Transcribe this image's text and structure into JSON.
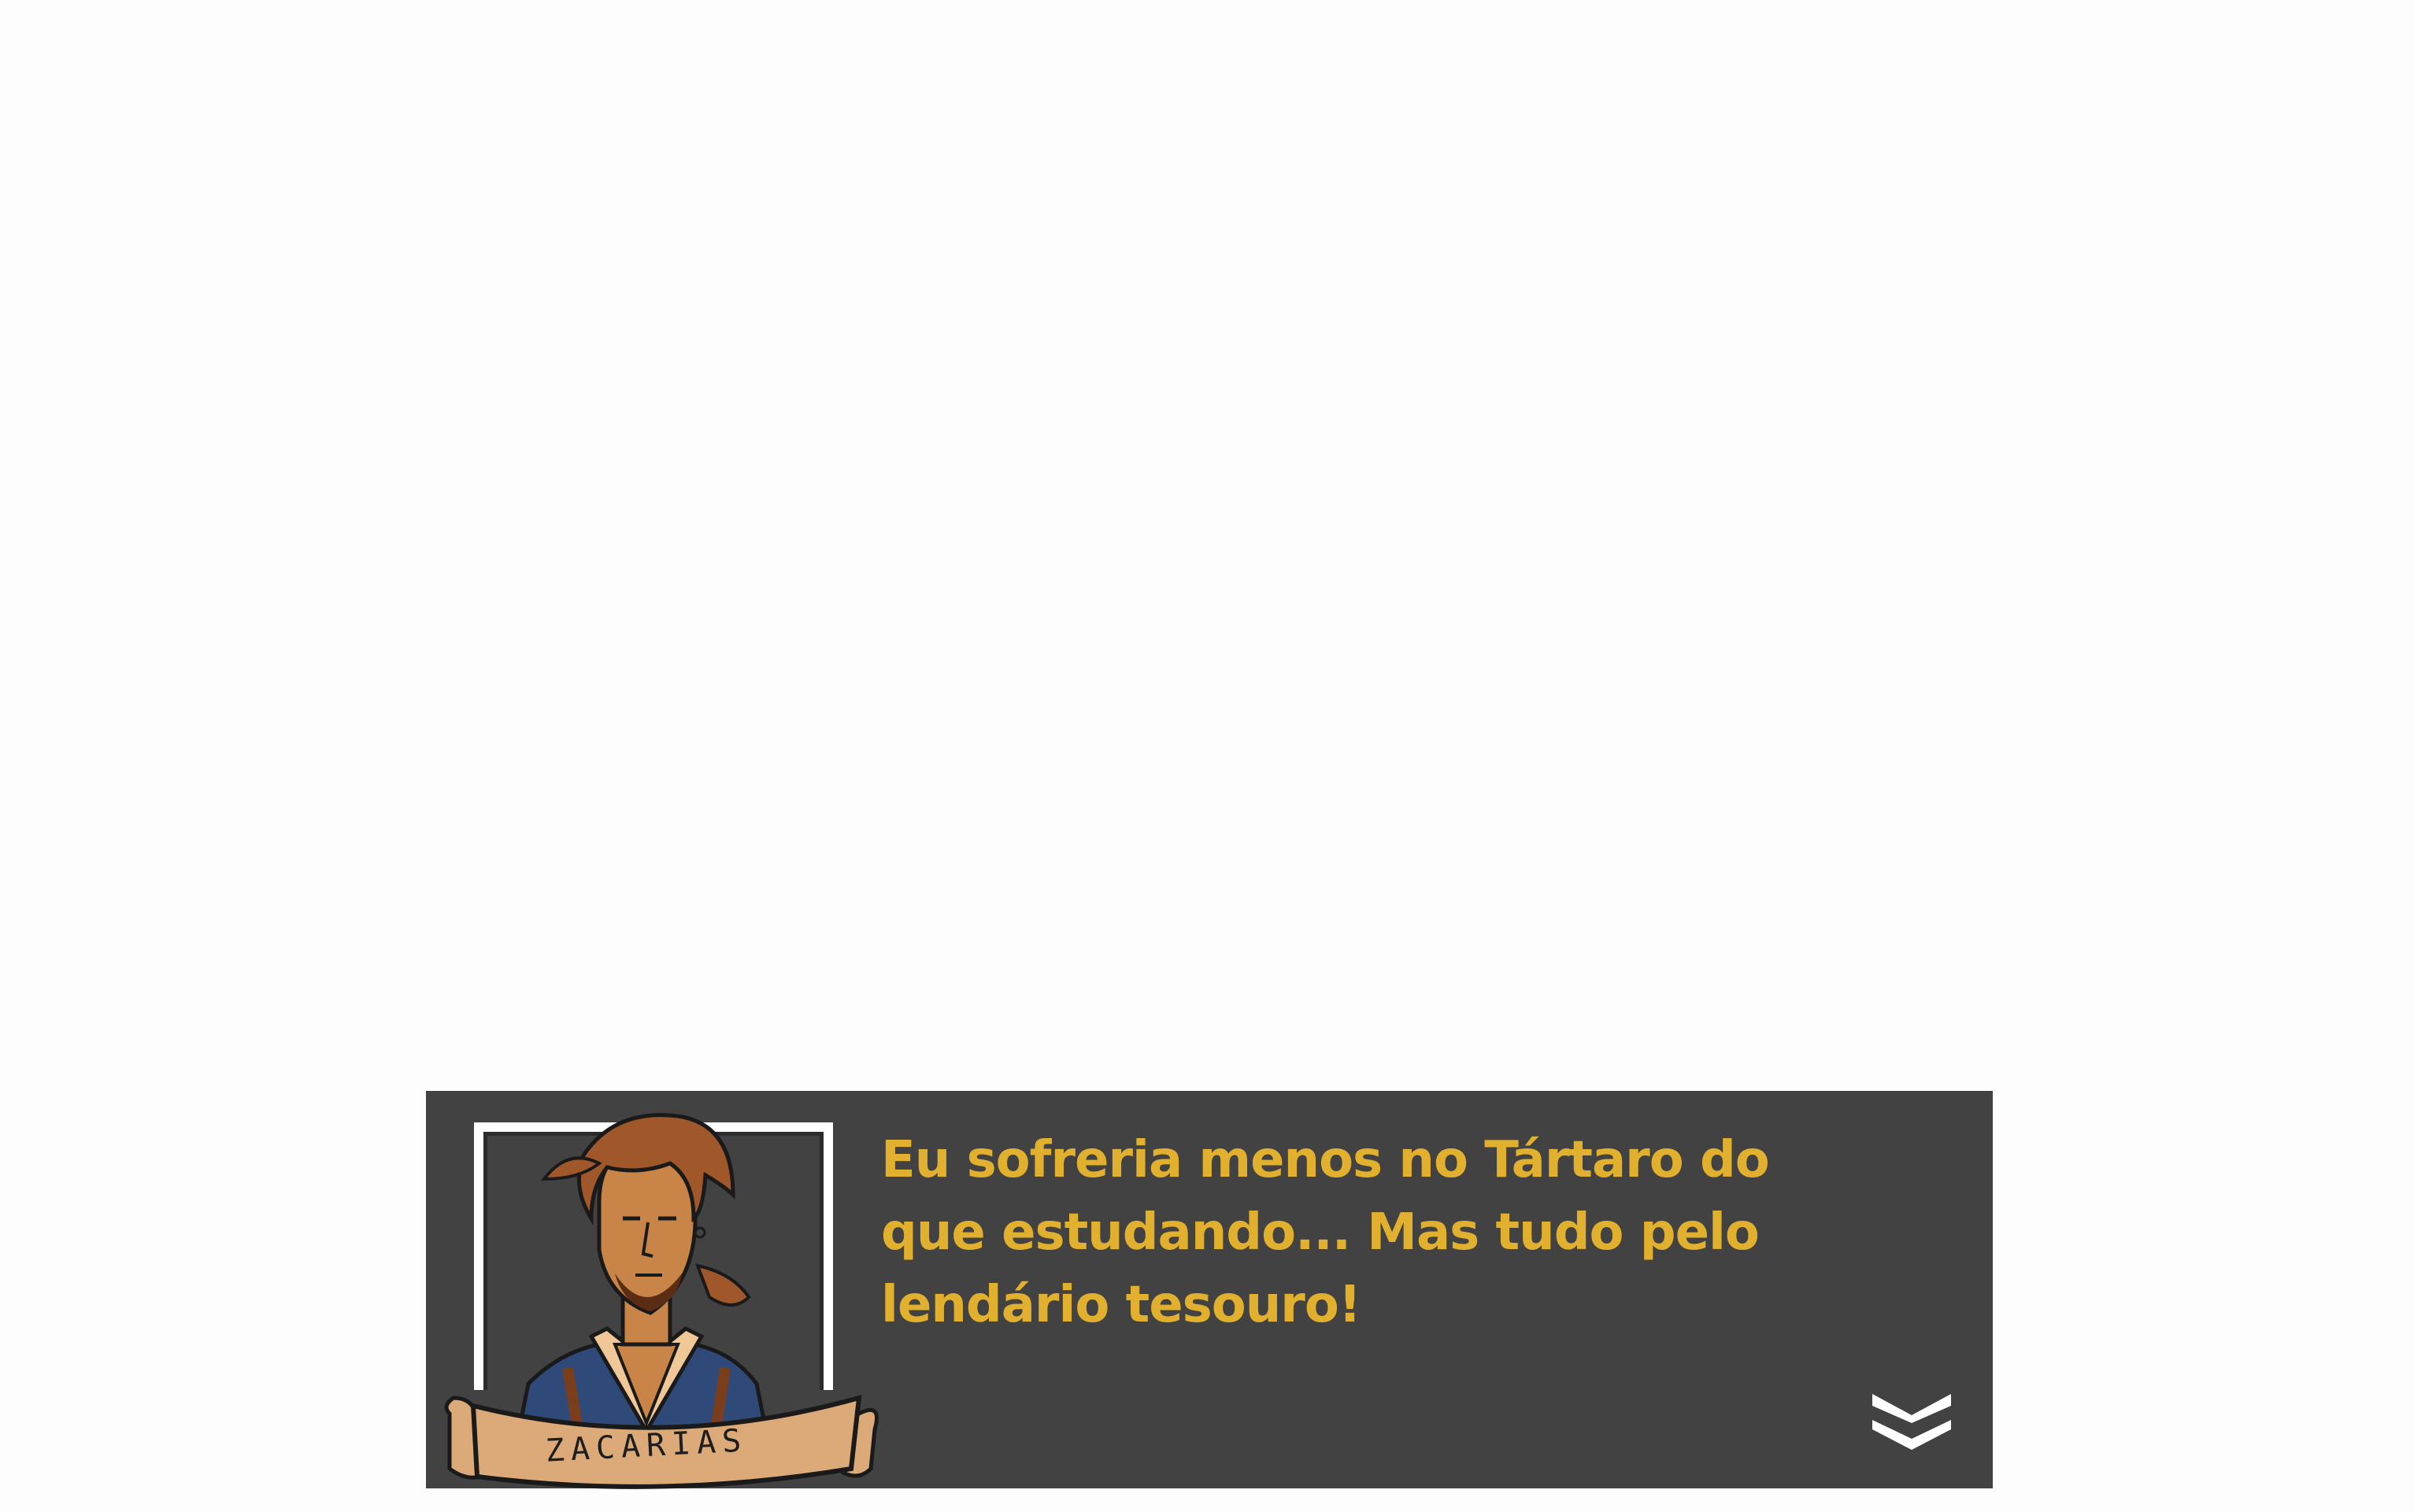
{
  "dialog": {
    "speaker_name": "ZACARIAS",
    "text": "Eu sofreria menos no Tártaro do que estudando... Mas tudo pelo lendário tesouro!"
  },
  "icons": {
    "advance": "double-chevron-down-icon"
  },
  "colors": {
    "background": "#fdfdfd",
    "dialog_box": "#424242",
    "dialog_text": "#e0b02e",
    "frame": "#ffffff",
    "banner": "#dcaa78"
  }
}
